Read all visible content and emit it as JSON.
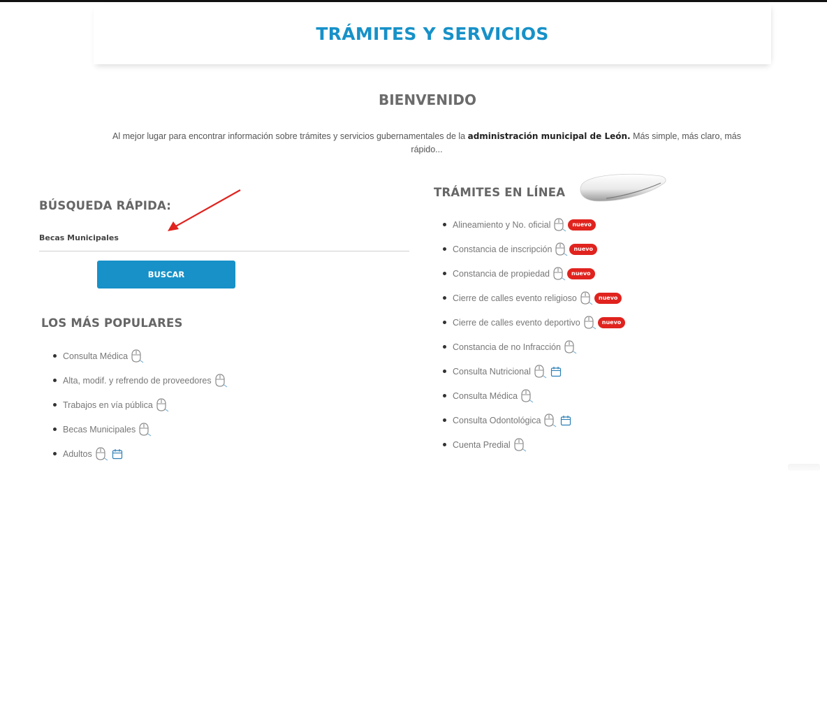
{
  "header": {
    "title": "TRÁMITES Y SERVICIOS"
  },
  "welcome": {
    "title": "BIENVENIDO",
    "text_before": "Al mejor lugar para encontrar información sobre trámites y servicios gubernamentales de la ",
    "text_bold": "administración municipal de León.",
    "text_after": " Más simple, más claro, más rápido..."
  },
  "search": {
    "title": "BÚSQUEDA RÁPIDA:",
    "value": "Becas Municipales",
    "button_label": "BUSCAR"
  },
  "popular": {
    "title": "LOS MÁS POPULARES",
    "items": [
      {
        "label": "Consulta Médica",
        "icons": [
          "mouse-icon"
        ]
      },
      {
        "label": "Alta, modif. y refrendo de proveedores",
        "icons": [
          "mouse-icon"
        ]
      },
      {
        "label": "Trabajos en vía pública",
        "icons": [
          "mouse-icon"
        ]
      },
      {
        "label": "Becas Municipales",
        "icons": [
          "mouse-icon"
        ]
      },
      {
        "label": "Adultos",
        "icons": [
          "mouse-icon",
          "calendar-icon"
        ]
      }
    ]
  },
  "online": {
    "title": "TRÁMITES EN LÍNEA",
    "badge_label": "nuevo",
    "badge_color": "#e0231e",
    "items": [
      {
        "label": "Alineamiento y No. oficial",
        "icons": [
          "mouse-icon"
        ],
        "new": true
      },
      {
        "label": "Constancia de inscripción",
        "icons": [
          "mouse-icon"
        ],
        "new": true
      },
      {
        "label": "Constancia de propiedad",
        "icons": [
          "mouse-icon"
        ],
        "new": true
      },
      {
        "label": "Cierre de calles evento religioso",
        "icons": [
          "mouse-icon"
        ],
        "new": true
      },
      {
        "label": "Cierre de calles evento deportivo",
        "icons": [
          "mouse-icon"
        ],
        "new": true
      },
      {
        "label": "Constancia de no Infracción",
        "icons": [
          "mouse-icon"
        ],
        "new": false
      },
      {
        "label": "Consulta Nutricional",
        "icons": [
          "mouse-icon",
          "calendar-icon"
        ],
        "new": false
      },
      {
        "label": "Consulta Médica",
        "icons": [
          "mouse-icon"
        ],
        "new": false
      },
      {
        "label": "Consulta Odontológica",
        "icons": [
          "mouse-icon",
          "calendar-icon"
        ],
        "new": false
      },
      {
        "label": "Cuenta Predial",
        "icons": [
          "mouse-icon"
        ],
        "new": false
      }
    ]
  },
  "colors": {
    "accent": "#1791c8",
    "badge": "#e0231e",
    "arrow": "#e0231e"
  }
}
